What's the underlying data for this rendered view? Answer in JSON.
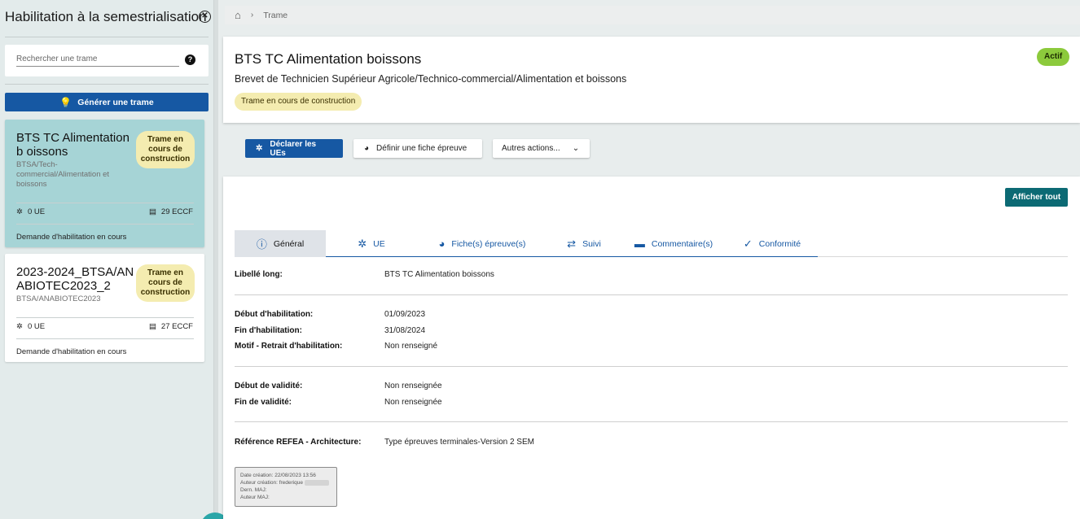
{
  "sidebar": {
    "title": "Habilitation à la semestrialisation",
    "search_placeholder": "Rechercher une trame",
    "generate_label": "Générer une trame",
    "cards": [
      {
        "title": "BTS TC Alimentation b oissons",
        "subtitle": "BTSA/Tech-commercial/Alimentation et boissons",
        "badge": "Trame en cours de construction",
        "ue": "0 UE",
        "eccf": "29 ECCF",
        "status": "Demande d'habilitation en cours"
      },
      {
        "title": "2023-2024_BTSA/AN ABIOTEC2023_2",
        "subtitle": "BTSA/ANABIOTEC2023",
        "badge": "Trame en cours de construction",
        "ue": "0 UE",
        "eccf": "27 ECCF",
        "status": "Demande d'habilitation en cours"
      }
    ]
  },
  "breadcrumb": {
    "current": "Trame"
  },
  "header": {
    "title": "BTS TC Alimentation boissons",
    "subtitle": "Brevet de Technicien Supérieur Agricole/Technico-commercial/Alimentation et boissons",
    "badge": "Trame en cours de construction",
    "status": "Actif"
  },
  "actions": {
    "declare": "Déclarer les UEs",
    "define": "Définir une fiche épreuve",
    "other": "Autres actions..."
  },
  "content": {
    "show_all": "Afficher tout",
    "tabs": [
      "Général",
      "UE",
      "Fiche(s) épreuve(s)",
      "Suivi",
      "Commentaire(s)",
      "Conformité"
    ],
    "fields": {
      "libelle_k": "Libellé long:",
      "libelle_v": "BTS TC Alimentation boissons",
      "debut_hab_k": "Début d'habilitation:",
      "debut_hab_v": "01/09/2023",
      "fin_hab_k": "Fin d'habilitation:",
      "fin_hab_v": "31/08/2024",
      "motif_k": "Motif - Retrait d'habilitation:",
      "motif_v": "Non renseigné",
      "debut_val_k": "Début de validité:",
      "debut_val_v": "Non renseignée",
      "fin_val_k": "Fin de validité:",
      "fin_val_v": "Non renseignée",
      "ref_k": "Référence REFEA - Architecture:",
      "ref_v": "Type épreuves terminales-Version 2 SEM"
    },
    "meta": {
      "date_creation": "Date création: 22/08/2023 13:56",
      "auteur_creation": "Auteur création: frederique",
      "dern_maj": "Dern. MAJ:",
      "auteur_maj": "Auteur MAJ:"
    }
  }
}
